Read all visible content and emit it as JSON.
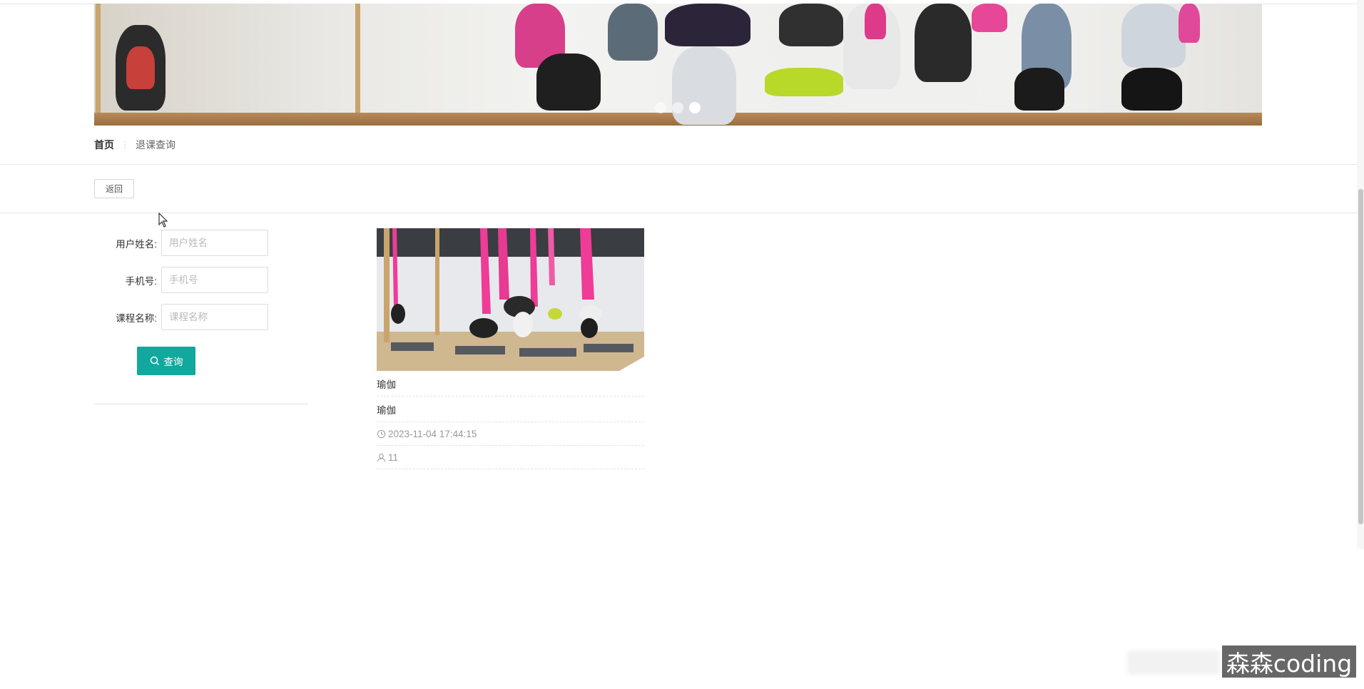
{
  "banner": {
    "slides": 3,
    "active_slide": 3
  },
  "breadcrumb": {
    "home": "首页",
    "separator": "⋮",
    "current": "退课查询"
  },
  "toolbar": {
    "back_label": "返回"
  },
  "form": {
    "fields": [
      {
        "label": "用户姓名:",
        "placeholder": "用户姓名",
        "value": ""
      },
      {
        "label": "手机号:",
        "placeholder": "手机号",
        "value": ""
      },
      {
        "label": "课程名称:",
        "placeholder": "课程名称",
        "value": ""
      }
    ],
    "search_label": "查询",
    "search_icon": "search-icon"
  },
  "card": {
    "title": "瑜伽",
    "course": "瑜伽",
    "time": "2023-11-04 17:44:15",
    "time_icon": "clock-icon",
    "count": "11",
    "count_icon": "user-icon"
  },
  "watermark": "森森coding",
  "colors": {
    "accent": "#13a89e",
    "text": "#333333",
    "muted": "#999999",
    "border": "#e6e6e6"
  }
}
